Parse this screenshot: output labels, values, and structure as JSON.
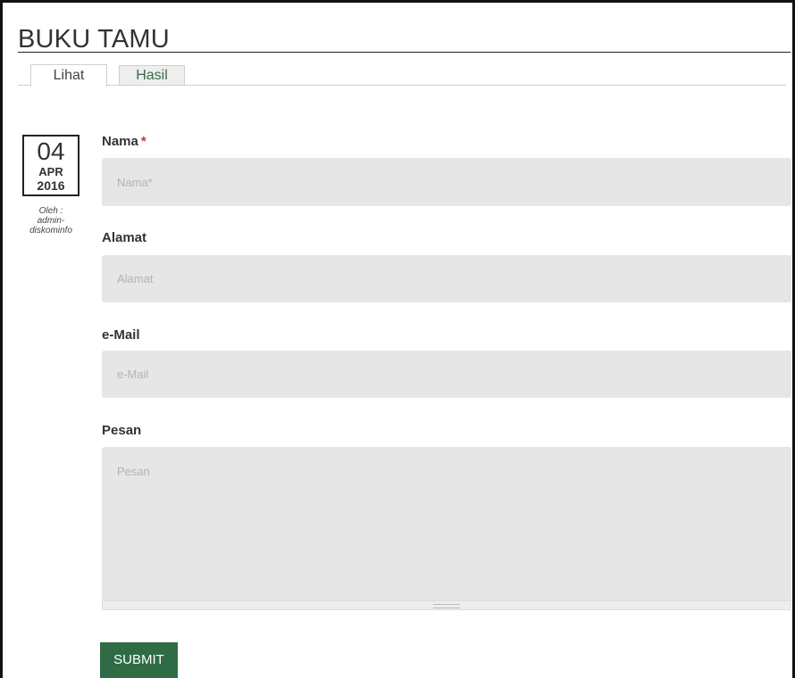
{
  "page": {
    "title": "BUKU TAMU"
  },
  "tabs": [
    {
      "label": "Lihat",
      "active": true
    },
    {
      "label": "Hasil",
      "active": false
    }
  ],
  "post_date": {
    "day": "04",
    "month": "APR",
    "year": "2016",
    "byline": [
      "Oleh :",
      "admin-",
      "diskominfo"
    ]
  },
  "form": {
    "fields": [
      {
        "label": "Nama",
        "required_marker": "*",
        "placeholder": "Nama*",
        "value": ""
      },
      {
        "label": "Alamat",
        "placeholder": "Alamat",
        "value": ""
      },
      {
        "label": "e-Mail",
        "placeholder": "e-Mail",
        "value": ""
      },
      {
        "label": "Pesan",
        "placeholder": "Pesan",
        "value": ""
      }
    ],
    "submit_label": "SUBMIT"
  },
  "colors": {
    "accent_green": "#2f6b45",
    "tab_text_green": "#3a6b45",
    "required_red": "#c0392b",
    "input_background": "#e6e6e6"
  }
}
